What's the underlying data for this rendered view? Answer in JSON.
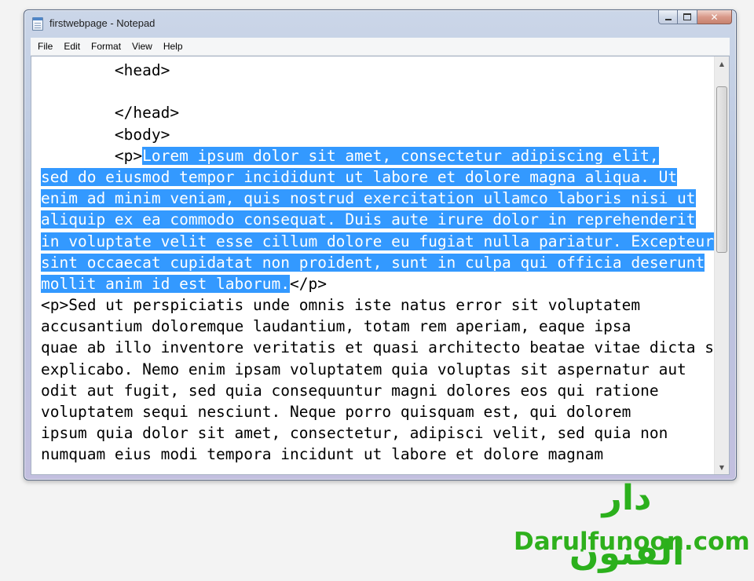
{
  "window": {
    "title": "firstwebpage - Notepad",
    "icon": "notepad-icon",
    "controls": {
      "minimize": "minimize-icon",
      "maximize": "maximize-icon",
      "close": "✕"
    }
  },
  "menu": {
    "items": [
      "File",
      "Edit",
      "Format",
      "View",
      "Help"
    ]
  },
  "editor": {
    "indent": "\t",
    "lines": [
      {
        "pre": "\t<head>",
        "sel": "",
        "post": ""
      },
      {
        "pre": "",
        "sel": "",
        "post": ""
      },
      {
        "pre": "\t</head>",
        "sel": "",
        "post": ""
      },
      {
        "pre": "\t<body>",
        "sel": "",
        "post": ""
      },
      {
        "pre": "\t<p>",
        "sel": "Lorem ipsum dolor sit amet, consectetur adipiscing elit,",
        "post": ""
      },
      {
        "pre": "",
        "sel": "sed do eiusmod tempor incididunt ut labore et dolore magna aliqua. Ut",
        "post": ""
      },
      {
        "pre": "",
        "sel": "enim ad minim veniam, quis nostrud exercitation ullamco laboris nisi ut",
        "post": ""
      },
      {
        "pre": "",
        "sel": "aliquip ex ea commodo consequat. Duis aute irure dolor in reprehenderit",
        "post": ""
      },
      {
        "pre": "",
        "sel": "in voluptate velit esse cillum dolore eu fugiat nulla pariatur. Excepteur",
        "post": ""
      },
      {
        "pre": "",
        "sel": "sint occaecat cupidatat non proident, sunt in culpa qui officia deserunt",
        "post": ""
      },
      {
        "pre": "",
        "sel": "mollit anim id est laborum.",
        "post": "</p>"
      },
      {
        "pre": "<p>Sed ut perspiciatis unde omnis iste natus error sit voluptatem",
        "sel": "",
        "post": ""
      },
      {
        "pre": "accusantium doloremque laudantium, totam rem aperiam, eaque ipsa",
        "sel": "",
        "post": ""
      },
      {
        "pre": "quae ab illo inventore veritatis et quasi architecto beatae vitae dicta sunt",
        "sel": "",
        "post": ""
      },
      {
        "pre": "explicabo. Nemo enim ipsam voluptatem quia voluptas sit aspernatur aut",
        "sel": "",
        "post": ""
      },
      {
        "pre": "odit aut fugit, sed quia consequuntur magni dolores eos qui ratione",
        "sel": "",
        "post": ""
      },
      {
        "pre": "voluptatem sequi nesciunt. Neque porro quisquam est, qui dolorem",
        "sel": "",
        "post": ""
      },
      {
        "pre": "ipsum quia dolor sit amet, consectetur, adipisci velit, sed quia non",
        "sel": "",
        "post": ""
      },
      {
        "pre": "numquam eius modi tempora incidunt ut labore et dolore magnam",
        "sel": "",
        "post": ""
      }
    ]
  },
  "scrollbar": {
    "position_fraction": 0.0,
    "up_icon": "▲",
    "down_icon": "▼"
  },
  "watermark": {
    "urdu": "دار الفنون",
    "latin": "Darulfunoon.com",
    "color": "#2bb01c"
  },
  "colors": {
    "selection": "#3399ff",
    "selection_text": "#ffffff"
  }
}
